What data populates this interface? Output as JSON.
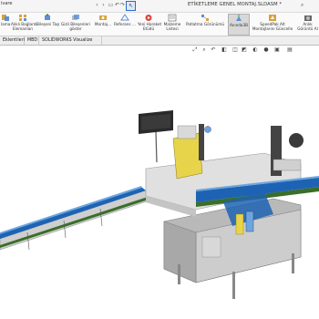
{
  "titlebar": {
    "app_text": "ivare",
    "document_title": "ETİKETLEME GENEL MONTAJ.SLDASM *",
    "quick_access": [
      "arrow-left-icon",
      "arrow-right-icon",
      "print-icon",
      "undo-icon",
      "redo-icon"
    ],
    "search_icon": "search-icon"
  },
  "ribbon": {
    "buttons": [
      {
        "line1": "lama",
        "line2": ""
      },
      {
        "line1": "Alıklı Bağlantı",
        "line2": "Elemanları"
      },
      {
        "line1": "Bileşeni Taşı",
        "line2": ""
      },
      {
        "line1": "Gizli Bileşenleri",
        "line2": "göster"
      },
      {
        "line1": "Montaj...",
        "line2": ""
      },
      {
        "line1": "Referans ...",
        "line2": ""
      },
      {
        "line1": "Yeni Hareket",
        "line2": "Etüdü"
      },
      {
        "line1": "Malzeme",
        "line2": "Listesi"
      },
      {
        "line1": "Patlatma Görünümü",
        "line2": ""
      },
      {
        "line1": "Anında3B",
        "line2": ""
      },
      {
        "line1": "SpeedPak Alt",
        "line2": "Montajlarını Güncelle"
      },
      {
        "line1": "Anlık",
        "line2": "Görüntü Al"
      }
    ]
  },
  "tabs": [
    {
      "label": "Eklentileri",
      "active": false
    },
    {
      "label": "MBD",
      "active": false
    },
    {
      "label": "SOLIDWORKS Visualize",
      "active": false
    }
  ],
  "colors": {
    "conveyor_belt": "#1e63b3",
    "belt_edge": "#6aa6e0",
    "frame_grey": "#c8c8c8",
    "rail_green": "#3a6e2a",
    "label_yellow": "#e7d44a",
    "panel_dark": "#2a2a2a"
  }
}
